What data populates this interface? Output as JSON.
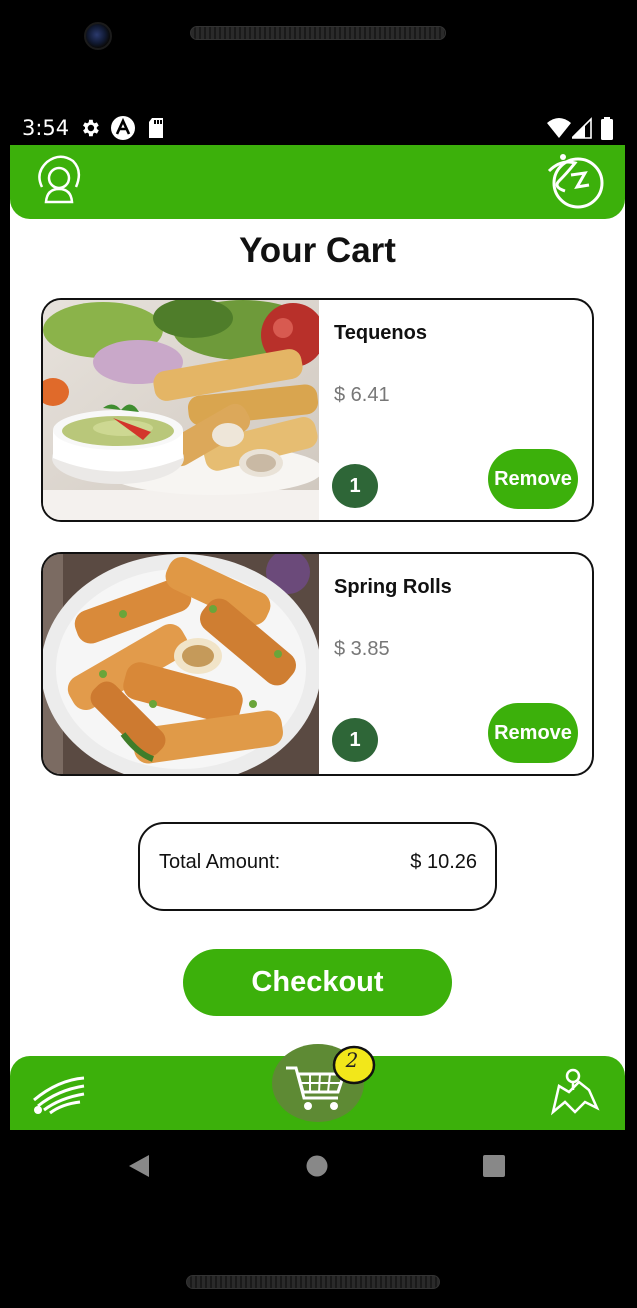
{
  "status_bar": {
    "time": "3:54",
    "left_icons": [
      "gear-icon",
      "app-a-icon",
      "sd-card-icon"
    ],
    "right_icons": [
      "wifi-icon",
      "signal-icon",
      "battery-icon"
    ]
  },
  "top_bar": {
    "left_icon": "profile-icon",
    "right_icon": "logo-icon",
    "color": "#3cb00b"
  },
  "page": {
    "title": "Your Cart"
  },
  "cart": {
    "items": [
      {
        "name": "Tequenos",
        "price": "$ 6.41",
        "quantity": "1",
        "remove_label": "Remove",
        "image": "tequenos-image"
      },
      {
        "name": "Spring Rolls",
        "price": "$ 3.85",
        "quantity": "1",
        "remove_label": "Remove",
        "image": "spring-rolls-image"
      }
    ],
    "total_label": "Total Amount:",
    "total_value": "$ 10.26",
    "checkout_label": "Checkout"
  },
  "bottom_bar": {
    "left_icon": "wifi-feed-icon",
    "center_icon": "cart-icon",
    "cart_count": "2",
    "right_icon": "map-icon"
  },
  "nav": {
    "buttons": [
      "back-icon",
      "home-icon",
      "recents-icon"
    ]
  }
}
